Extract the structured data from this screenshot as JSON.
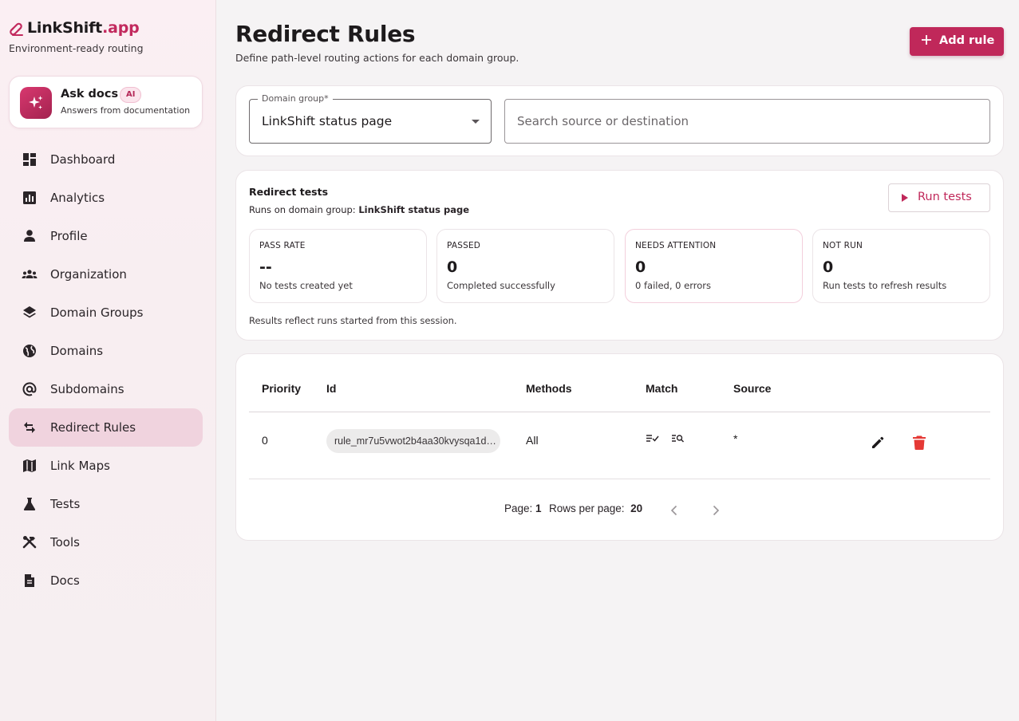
{
  "brand": {
    "name": "LinkShift",
    "tld": ".app",
    "tagline": "Environment-ready routing"
  },
  "ask_docs": {
    "title": "Ask docs",
    "badge": "AI",
    "subtitle": "Answers from documentation"
  },
  "sidebar": {
    "active": "Redirect Rules",
    "items": [
      {
        "label": "Dashboard",
        "icon": "dashboard-icon"
      },
      {
        "label": "Analytics",
        "icon": "analytics-icon"
      },
      {
        "label": "Profile",
        "icon": "person-icon"
      },
      {
        "label": "Organization",
        "icon": "group-icon"
      },
      {
        "label": "Domain Groups",
        "icon": "layers-icon"
      },
      {
        "label": "Domains",
        "icon": "globe-icon"
      },
      {
        "label": "Subdomains",
        "icon": "at-sign-icon"
      },
      {
        "label": "Redirect Rules",
        "icon": "swap-arrows-icon"
      },
      {
        "label": "Link Maps",
        "icon": "map-icon"
      },
      {
        "label": "Tests",
        "icon": "flask-icon"
      },
      {
        "label": "Tools",
        "icon": "tools-icon"
      },
      {
        "label": "Docs",
        "icon": "document-icon"
      }
    ]
  },
  "header": {
    "title": "Redirect Rules",
    "subtitle": "Define path-level routing actions for each domain group.",
    "add_label": "Add rule"
  },
  "filters": {
    "domain_group_label": "Domain group*",
    "domain_group_value": "LinkShift status page",
    "search_placeholder": "Search source or destination",
    "search_value": ""
  },
  "tests": {
    "title": "Redirect tests",
    "runs_on_prefix": "Runs on domain group: ",
    "runs_on_group": "LinkShift status page",
    "run_label": "Run tests",
    "stats": [
      {
        "label": "PASS RATE",
        "value": "--",
        "desc": "No tests created yet"
      },
      {
        "label": "PASSED",
        "value": "0",
        "desc": "Completed successfully"
      },
      {
        "label": "NEEDS ATTENTION",
        "value": "0",
        "desc": "0 failed, 0 errors"
      },
      {
        "label": "NOT RUN",
        "value": "0",
        "desc": "Run tests to refresh results"
      }
    ],
    "footnote": "Results reflect runs started from this session."
  },
  "table": {
    "columns": [
      "Priority",
      "Id",
      "Methods",
      "Match",
      "Source"
    ],
    "rows": [
      {
        "priority": "0",
        "id": "rule_mr7u5vwot2b4aa30kvysqa1d…",
        "methods": "All",
        "source": "*",
        "match_icons": [
          "match-rules-icon",
          "match-search-icon"
        ]
      }
    ],
    "pagination": {
      "page_label": "Page:",
      "page": "1",
      "rows_label": "Rows per page:",
      "rows_per_page": "20"
    }
  },
  "colors": {
    "accent": "#c0285a",
    "active_nav": "#f0d3de",
    "delete": "#e53935"
  }
}
